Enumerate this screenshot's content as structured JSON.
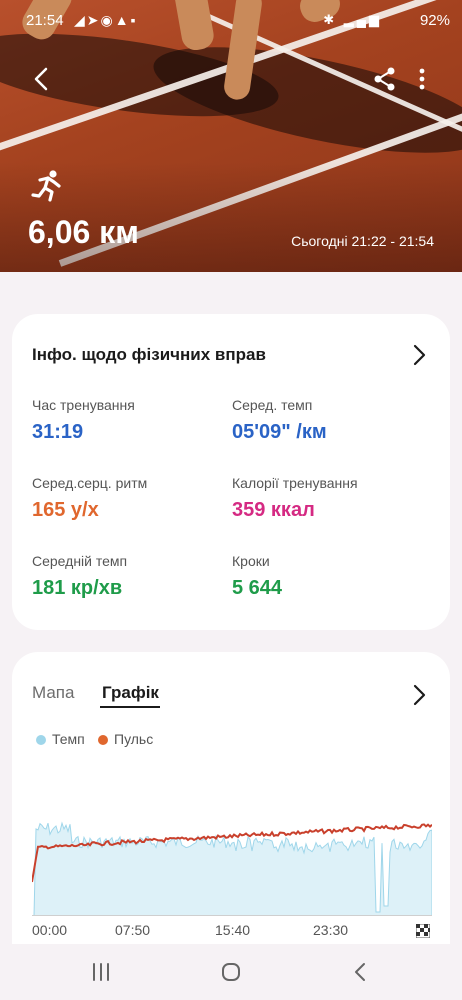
{
  "status_bar": {
    "time": "21:54",
    "battery": "92%"
  },
  "header": {
    "activity_icon": "running-icon",
    "distance": "6,06 км",
    "date_range": "Сьогодні 21:22 - 21:54"
  },
  "exercise_info": {
    "title": "Інфо. щодо фізичних вправ",
    "metrics": [
      {
        "label": "Час тренування",
        "value": "31:19",
        "color": "#2a63c6"
      },
      {
        "label": "Серед. темп",
        "value": "05'09\" /км",
        "color": "#2a63c6"
      },
      {
        "label": "Серед.серц. ритм",
        "value": "165 у/х",
        "color": "#e0672e"
      },
      {
        "label": "Калорії тренування",
        "value": "359 ккал",
        "color": "#d52a83"
      },
      {
        "label": "Середній темп",
        "value": "181 кр/хв",
        "color": "#1f9c4a"
      },
      {
        "label": "Кроки",
        "value": "5 644",
        "color": "#1f9c4a"
      }
    ]
  },
  "graph_card": {
    "tabs": {
      "map": "Мапа",
      "graph": "Графік"
    },
    "legend": {
      "pace": "Темп",
      "pulse": "Пульс"
    },
    "x_ticks": [
      "00:00",
      "07:50",
      "15:40",
      "23:30"
    ]
  },
  "colors": {
    "pace": "#9fd6ea",
    "pulse": "#c9402c"
  },
  "chart_data": {
    "type": "area",
    "x": [
      "00:00",
      "07:50",
      "15:40",
      "23:30",
      "31:19"
    ],
    "series": [
      {
        "name": "Темп"
      },
      {
        "name": "Пульс"
      }
    ]
  }
}
